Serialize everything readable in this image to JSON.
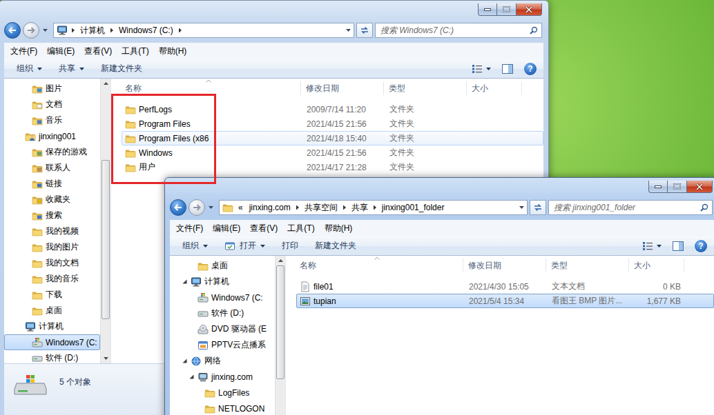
{
  "windows": [
    {
      "active": false,
      "address": {
        "kind": "computer",
        "crumbs": [
          "计算机",
          "Windows7 (C:)"
        ],
        "trailing_separator": true
      },
      "search": {
        "placeholder": "搜索 Windows7 (C:)"
      },
      "menu": [
        "文件(F)",
        "编辑(E)",
        "查看(V)",
        "工具(T)",
        "帮助(H)"
      ],
      "toolbar": [
        {
          "label": "组织",
          "dropdown": true,
          "kind": "plain"
        },
        {
          "label": "共享",
          "dropdown": true,
          "kind": "plain"
        },
        {
          "label": "新建文件夹",
          "dropdown": false,
          "kind": "plain"
        }
      ],
      "help": "?",
      "nav": {
        "scroll": {
          "position": 0.27,
          "size": 0.6
        },
        "items": [
          {
            "label": "图片",
            "level": 2,
            "kind": "pictures",
            "selected": false
          },
          {
            "label": "文档",
            "level": 2,
            "kind": "documents",
            "selected": false
          },
          {
            "label": "音乐",
            "level": 2,
            "kind": "music",
            "selected": false
          },
          {
            "label": "jinxing001",
            "level": 1,
            "kind": "user",
            "selected": false
          },
          {
            "label": "保存的游戏",
            "level": 2,
            "kind": "games",
            "selected": false
          },
          {
            "label": "联系人",
            "level": 2,
            "kind": "contacts",
            "selected": false
          },
          {
            "label": "链接",
            "level": 2,
            "kind": "links",
            "selected": false
          },
          {
            "label": "收藏夹",
            "level": 2,
            "kind": "favorites",
            "selected": false
          },
          {
            "label": "搜索",
            "level": 2,
            "kind": "search",
            "selected": false
          },
          {
            "label": "我的视频",
            "level": 2,
            "kind": "folder",
            "selected": false
          },
          {
            "label": "我的图片",
            "level": 2,
            "kind": "folder",
            "selected": false
          },
          {
            "label": "我的文档",
            "level": 2,
            "kind": "folder",
            "selected": false
          },
          {
            "label": "我的音乐",
            "level": 2,
            "kind": "folder",
            "selected": false
          },
          {
            "label": "下载",
            "level": 2,
            "kind": "folder",
            "selected": false
          },
          {
            "label": "桌面",
            "level": 2,
            "kind": "folder",
            "selected": false
          },
          {
            "label": "计算机",
            "level": 1,
            "kind": "computer",
            "selected": false
          },
          {
            "label": "Windows7 (C:",
            "level": 2,
            "kind": "system-drive",
            "selected": true
          },
          {
            "label": "软件 (D:)",
            "level": 2,
            "kind": "drive",
            "selected": false
          }
        ]
      },
      "columns": [
        {
          "label": "名称",
          "sorted": true
        },
        {
          "label": "修改日期",
          "sorted": false
        },
        {
          "label": "类型",
          "sorted": false
        },
        {
          "label": "大小",
          "sorted": false
        }
      ],
      "rows": [
        {
          "name": "PerfLogs",
          "date": "2009/7/14 11:20",
          "type": "文件夹",
          "kind": "folder",
          "selected": false,
          "hot": false
        },
        {
          "name": "Program Files",
          "date": "2021/4/15 21:56",
          "type": "文件夹",
          "kind": "folder",
          "selected": false,
          "hot": false
        },
        {
          "name": "Program Files (x86",
          "date": "2021/4/18 15:40",
          "type": "文件夹",
          "kind": "folder",
          "selected": false,
          "hot": true
        },
        {
          "name": "Windows",
          "date": "2021/4/15 21:56",
          "type": "文件夹",
          "kind": "folder",
          "selected": false,
          "hot": false
        },
        {
          "name": "用户",
          "date": "2021/4/17 21:28",
          "type": "文件夹",
          "kind": "folder",
          "selected": false,
          "hot": false
        }
      ],
      "status": {
        "text": "5 个对象"
      }
    },
    {
      "active": true,
      "address": {
        "kind": "folder",
        "overflow": "«",
        "crumbs": [
          "jinxing.com",
          "共享空间",
          "共享",
          "jinxing001_folder"
        ],
        "trailing_separator": false
      },
      "search": {
        "placeholder": "搜索 jinxing001_folder"
      },
      "menu": [
        "文件(F)",
        "编辑(E)",
        "查看(V)",
        "工具(T)",
        "帮助(H)"
      ],
      "toolbar": [
        {
          "label": "组织",
          "dropdown": true,
          "kind": "plain"
        },
        {
          "label": "打开",
          "dropdown": true,
          "kind": "open"
        },
        {
          "label": "打印",
          "dropdown": false,
          "kind": "plain"
        },
        {
          "label": "新建文件夹",
          "dropdown": false,
          "kind": "plain"
        }
      ],
      "help": "?",
      "nav": {
        "scroll": {
          "position": 0,
          "size": 0.75
        },
        "items": [
          {
            "label": "桌面",
            "level": 2,
            "kind": "folder",
            "selected": false,
            "expanded": false
          },
          {
            "label": "计算机",
            "level": 1,
            "kind": "computer",
            "selected": false,
            "expanded": true
          },
          {
            "label": "Windows7 (C:",
            "level": 2,
            "kind": "system-drive",
            "selected": false,
            "expanded": false
          },
          {
            "label": "软件 (D:)",
            "level": 2,
            "kind": "drive",
            "selected": false,
            "expanded": false
          },
          {
            "label": "DVD 驱动器 (E",
            "level": 2,
            "kind": "dvd",
            "selected": false,
            "expanded": false
          },
          {
            "label": "PPTV云点播系",
            "level": 2,
            "kind": "app",
            "selected": false,
            "expanded": false
          },
          {
            "label": "网络",
            "level": 1,
            "kind": "network",
            "selected": false,
            "expanded": true
          },
          {
            "label": "jinxing.com",
            "level": 2,
            "kind": "server",
            "selected": false,
            "expanded": true
          },
          {
            "label": "LogFiles",
            "level": 3,
            "kind": "folder",
            "selected": false,
            "expanded": false
          },
          {
            "label": "NETLOGON",
            "level": 3,
            "kind": "folder",
            "selected": false,
            "expanded": false
          }
        ]
      },
      "columns": [
        {
          "label": "名称",
          "sorted": true
        },
        {
          "label": "修改日期",
          "sorted": false
        },
        {
          "label": "类型",
          "sorted": false
        },
        {
          "label": "大小",
          "sorted": false
        }
      ],
      "rows": [
        {
          "name": "file01",
          "date": "2021/4/30 15:05",
          "type": "文本文档",
          "size": "0 KB",
          "kind": "text-file",
          "selected": false,
          "hot": false
        },
        {
          "name": "tupian",
          "date": "2021/5/4 15:34",
          "type": "看图王 BMP 图片...",
          "size": "1,677 KB",
          "kind": "image-file",
          "selected": true,
          "hot": false
        }
      ]
    }
  ]
}
